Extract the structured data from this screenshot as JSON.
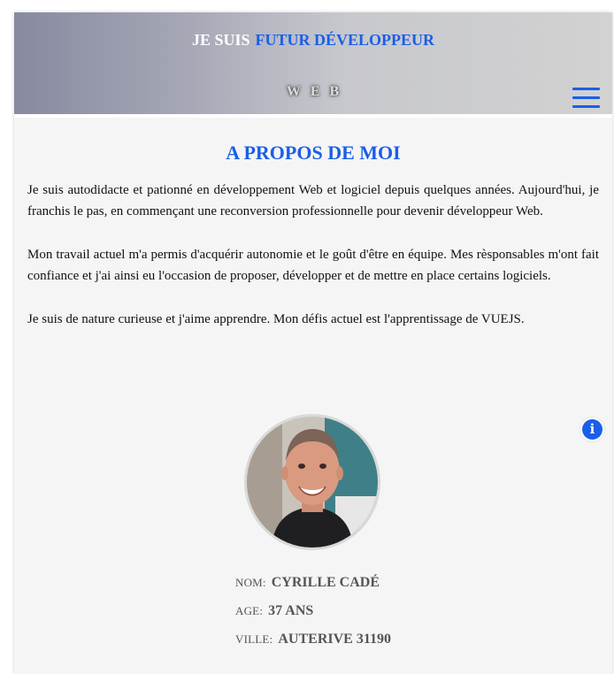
{
  "header": {
    "hero_prefix": "JE SUIS",
    "hero_accent": "FUTUR DÉVELOPPEUR",
    "hero_suffix": "WEB",
    "menu_icon": "hamburger-menu-icon",
    "accent_color": "#1a5ee8"
  },
  "about": {
    "title": "A PROPOS DE MOI",
    "paragraphs": [
      "Je suis autodidacte et pationné en développement Web et logiciel depuis quelques années. Aujourd'hui, je franchis le pas, en commençant une reconversion professionnelle pour devenir développeur Web.",
      "Mon travail actuel m'a permis d'acquérir autonomie et le goût d'être en équipe. Mes rèsponsables m'ont fait confiance et j'ai ainsi eu l'occasion de proposer, développer et de mettre en place certains logiciels.",
      "Je suis de nature curieuse et j'aime apprendre. Mon défis actuel est l'apprentissage de VUEJS."
    ]
  },
  "info_button": {
    "glyph": "i",
    "icon": "info-icon"
  },
  "profile": {
    "photo": "profile-photo",
    "fields": [
      {
        "label": "Nom:",
        "value": "CYRILLE CADÉ"
      },
      {
        "label": "Age:",
        "value": "37 ANS"
      },
      {
        "label": "Ville:",
        "value": "AUTERIVE 31190"
      }
    ]
  }
}
